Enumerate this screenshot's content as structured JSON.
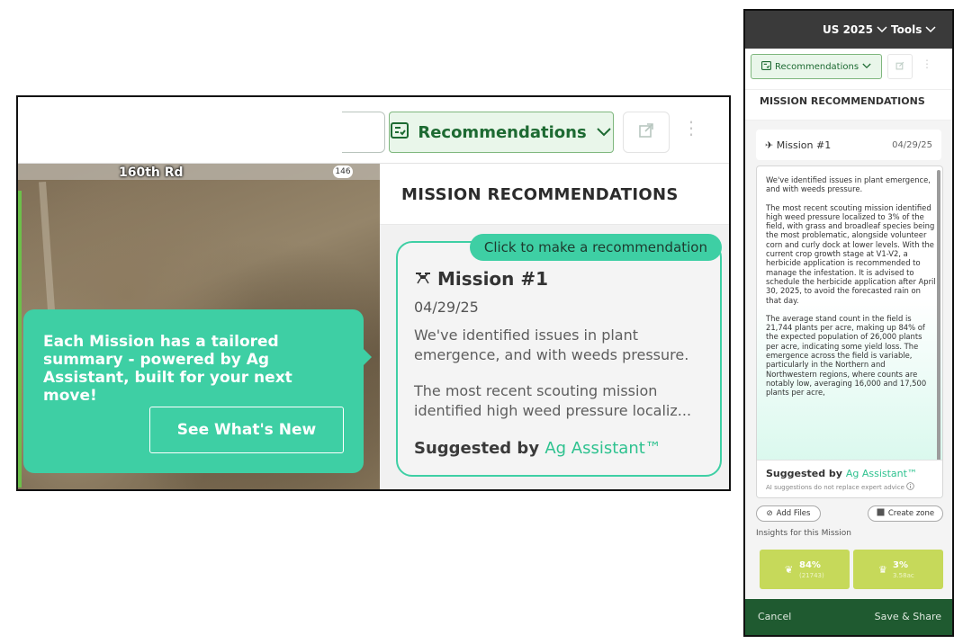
{
  "zoom": {
    "rec_label": "Recommendations",
    "map_road": "160th Rd",
    "map_shield": "146",
    "section_title": "MISSION RECOMMENDATIONS",
    "pill": "Click to make a recommendation",
    "mission_title": "Mission #1",
    "mission_date": "04/29/25",
    "para1": "We've identified issues in plant emergence, and with weeds pressure.",
    "para2": "The most recent scouting mission identified high weed pressure localiz...",
    "suggested_prefix": "Suggested by",
    "suggested_brand": "Ag Assistant™",
    "tooltip_text": "Each Mission has a tailored summary - powered by Ag Assistant, built for your next move!",
    "tooltip_button": "See What's New"
  },
  "phone": {
    "top_year": "US 2025",
    "top_tools": "Tools",
    "rec_label": "Recommendations",
    "section_title": "MISSION RECOMMENDATIONS",
    "mission_title": "Mission #1",
    "mission_date": "04/29/25",
    "para1": "We've identified issues in plant emergence, and with weeds pressure.",
    "para2": "The most recent scouting mission identified high weed pressure localized to 3% of the field, with grass and broadleaf species being the most problematic, alongside volunteer corn and curly dock at lower levels. With the current crop growth stage at V1-V2, a herbicide application is recommended to manage the infestation. It is advised to schedule the herbicide application after April 30, 2025, to avoid the forecasted rain on that day.",
    "para3": "The average stand count in the field is 21,744 plants per acre, making up 84% of the expected population of 26,000 plants per acre, indicating some yield loss. The emergence across the field is variable, particularly in the Northern and Northwestern regions, where counts are notably low, averaging 16,000 and 17,500 plants per acre,",
    "suggested_prefix": "Suggested by",
    "suggested_brand": "Ag Assistant™",
    "disclaimer": "AI suggestions do not replace expert advice",
    "add_files": "Add Files",
    "create_zone": "Create zone",
    "insights_label": "Insights for this Mission",
    "stat1_value": "84%",
    "stat1_sub": "(21743)",
    "stat2_value": "3%",
    "stat2_sub": "3.58ac",
    "cancel": "Cancel",
    "save_share": "Save & Share"
  },
  "colors": {
    "accent": "#3ecfa4",
    "brand_green": "#1f5a30",
    "stat_yellow": "#c6d95a"
  },
  "icons": [
    "recommendations-icon",
    "chevron-down-icon",
    "external-link-icon",
    "kebab-icon",
    "drone-icon",
    "info-icon",
    "paperclip-icon",
    "zone-icon",
    "sprout-icon",
    "weed-icon"
  ]
}
